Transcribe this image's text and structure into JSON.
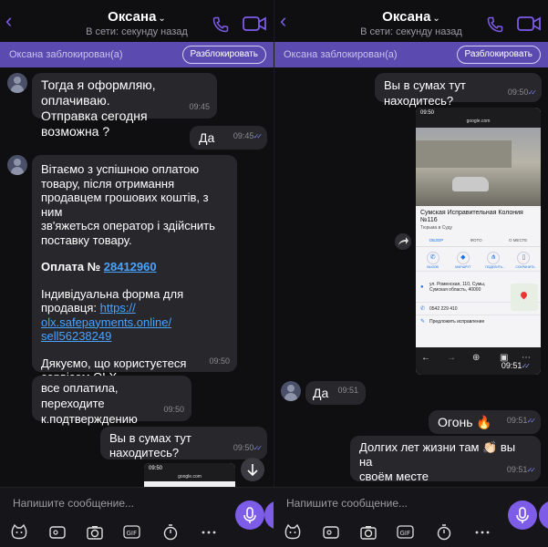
{
  "header": {
    "name": "Оксана",
    "status": "В сети: секунду назад"
  },
  "banner": {
    "text": "Оксана заблокирован(а)",
    "unblock_label": "Разблокировать"
  },
  "left": {
    "messages": [
      {
        "text": "Тогда я оформляю, оплачиваю.\nОтправка сегодня возможна ?",
        "time": "09:45"
      },
      {
        "text": "Да",
        "time": "09:45"
      },
      {
        "intro": "Вітаємо з успішною оплатою\nтовару, після отримання\nпродавцем грошових коштів, з ним\nзв'яжеться оператор і здійснить\nпоставку товару.",
        "payment_label": "Оплата № ",
        "payment_number": "28412960",
        "form_text": "Індивідуальна форма для\nпродавця: ",
        "link": "https://\nolx.safepayments.online/\nsell56238249",
        "thanks": "Дякуємо, що користуєтеся\nсервісом OLX",
        "time": "09:50"
      },
      {
        "text": "все оплатила, переходите\nк.подтверждению",
        "time": "09:50"
      },
      {
        "text": "Вы в сумах тут находитесь?",
        "time": "09:50"
      }
    ],
    "mini_preview": {
      "status_time": "09:50",
      "url": "google.com"
    }
  },
  "right": {
    "messages": [
      {
        "text": "Вы в сумах тут находитесь?",
        "time": "09:50"
      },
      {
        "text": "Да",
        "time": "09:51"
      },
      {
        "text": "Огонь 🔥",
        "time": "09:51"
      },
      {
        "text": "Долгих лет жизни там 👏🏻 вы на\nсвоём месте",
        "time": "09:51"
      }
    ],
    "screenshot": {
      "status_time": "09:50",
      "url": "google.com",
      "place_title": "Сумская Исправительная Колония №116",
      "category": "Тюрьма в Суду",
      "tabs": [
        "ОБЗОР",
        "ФОТО",
        "О МЕСТЕ"
      ],
      "actions": [
        "ВЫЗОВ",
        "МАРШРУТ",
        "ПОДЕЛИТЬ...",
        "СОХРАНИТЬ"
      ],
      "address": "ул. Роменская, 110, Сумы,\nСумская область, 40000",
      "phone": "0542 229 410",
      "suggest": "Предложить исправление",
      "time": "09:51"
    }
  },
  "composer": {
    "placeholder": "Напишите сообщение..."
  },
  "colors": {
    "accent": "#7d5ce8",
    "banner": "#5b4bb0",
    "bubble": "#27272c",
    "link": "#4aa3ff"
  }
}
